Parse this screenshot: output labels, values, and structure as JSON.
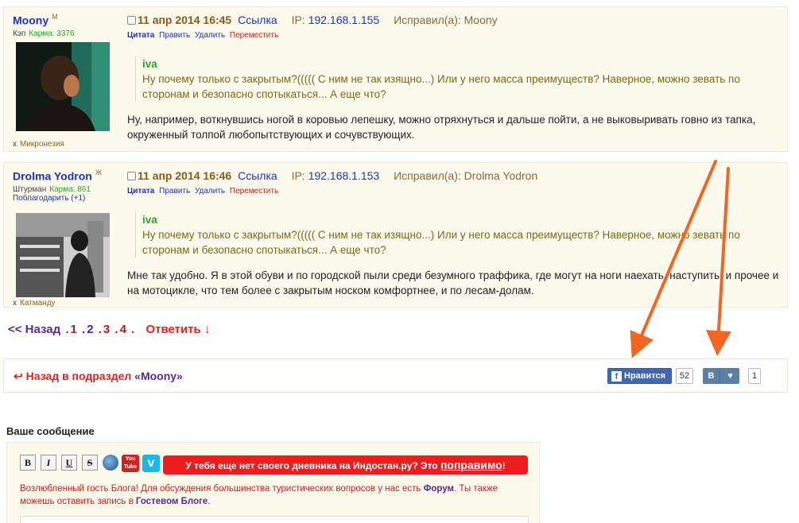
{
  "posts": [
    {
      "author": "Moony",
      "gender": "М",
      "rank": "Кэп",
      "karma": "Карма: 3376",
      "thanks": "",
      "location": "Микронезия",
      "loc_x": "x",
      "date": "11 апр 2014 16:45",
      "link": "Ссылка",
      "ip_label": "IP:",
      "ip": "192.168.1.155",
      "edited": "Исправил(а): Moony",
      "actions": {
        "quote": "Цитата",
        "edit": "Править",
        "delete": "Удалить",
        "move": "Переместить"
      },
      "quote_author": "iva",
      "quote_text": "Ну почему только с закрытым?((((( С ним не так изящно...) Или у него масса преимуществ? Наверное, можно зевать по сторонам и безопасно спотыкаться... А еще что?",
      "message": "Ну, например, воткнувшись ногой в коровью лепешку, можно отряхнуться и дальше пойти, а не выковыривать говно из тапка, окруженный толпой любопытствующих и сочувствующих."
    },
    {
      "author": "Drolma Yodron",
      "gender": "Ж",
      "rank": "Штурман",
      "karma": "Карма: 861",
      "thanks": "Поблагодарить (+1)",
      "location": "Катманду",
      "loc_x": "x",
      "date": "11 апр 2014 16:46",
      "link": "Ссылка",
      "ip_label": "IP:",
      "ip": "192.168.1.153",
      "edited": "Исправил(а): Drolma Yodron",
      "actions": {
        "quote": "Цитата",
        "edit": "Править",
        "delete": "Удалить",
        "move": "Переместить"
      },
      "quote_author": "iva",
      "quote_text": "Ну почему только с закрытым?((((( С ним не так изящно...) Или у него масса преимуществ? Наверное, можно зевать по сторонам и безопасно спотыкаться... А еще что?",
      "message": "Мне так удобно. Я в этой обуви и по городской пыли среди безумного траффика, где могут на ноги наехать, наступить, и прочее и на мотоцикле, что тем более с закрытым носком комфортнее, и по лесам-долам."
    }
  ],
  "pager": {
    "back": "<< Назад",
    "pages": [
      ".",
      "1",
      ".",
      "2",
      ".",
      "3",
      ".",
      "4",
      "."
    ],
    "reply": "Ответить ↓"
  },
  "back_bar": {
    "arrow": "↩",
    "text": "Назад в подраздел",
    "section": "«Moony»"
  },
  "social": {
    "fb_icon": "f",
    "fb_label": "Нравится",
    "fb_count": "52",
    "vk_label": "В",
    "vk_heart": "♥",
    "vk_count": "1"
  },
  "editor": {
    "title": "Ваше сообщение",
    "toolbar": [
      "B",
      "I",
      "U",
      "S"
    ],
    "youtube": "You Tube",
    "vimeo": "v",
    "promo_text": "У тебя еще нет своего дневника на Индостан.ру? Это",
    "promo_link": "поправимо",
    "promo_end": "!",
    "guest_1": "Возлюбленный гость Блога! Для обсуждения большинства туристических вопросов у нас есть",
    "guest_forum": "Форум",
    "guest_2": ". Ты также можешь оставить запись в",
    "guest_book": "Гостевом Блоге",
    "guest_3": "."
  },
  "colors": {
    "accent_red": "#ee1c1c",
    "link_blue": "#2233bb",
    "fb_blue": "#4267b2",
    "vk_blue": "#5b7fa6",
    "arrow_orange": "#f26522"
  }
}
